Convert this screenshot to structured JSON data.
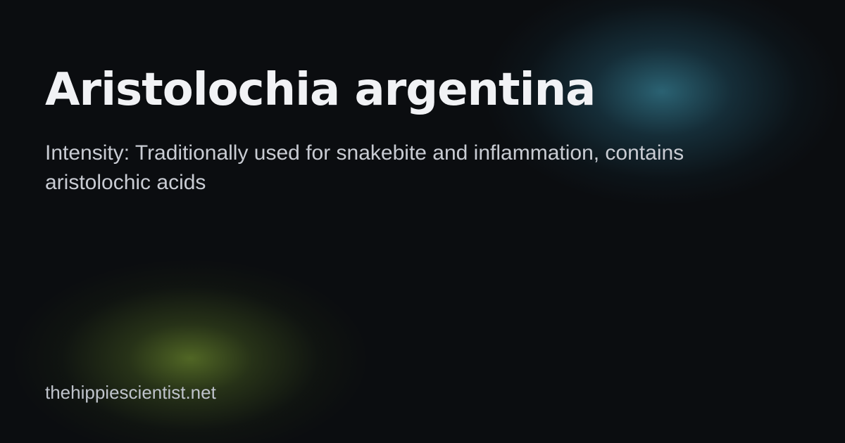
{
  "card": {
    "title": "Aristolochia argentina",
    "subtitle": "Intensity: Traditionally used for snakebite and inflammation, contains aristolochic acids",
    "site": "thehippiescientist.net"
  },
  "colors": {
    "background": "#0b0d10",
    "title_text": "#f1f2f5",
    "body_text": "#c9ccd3",
    "glow_teal": "#3e96af",
    "glow_green": "#6e8c2d"
  }
}
